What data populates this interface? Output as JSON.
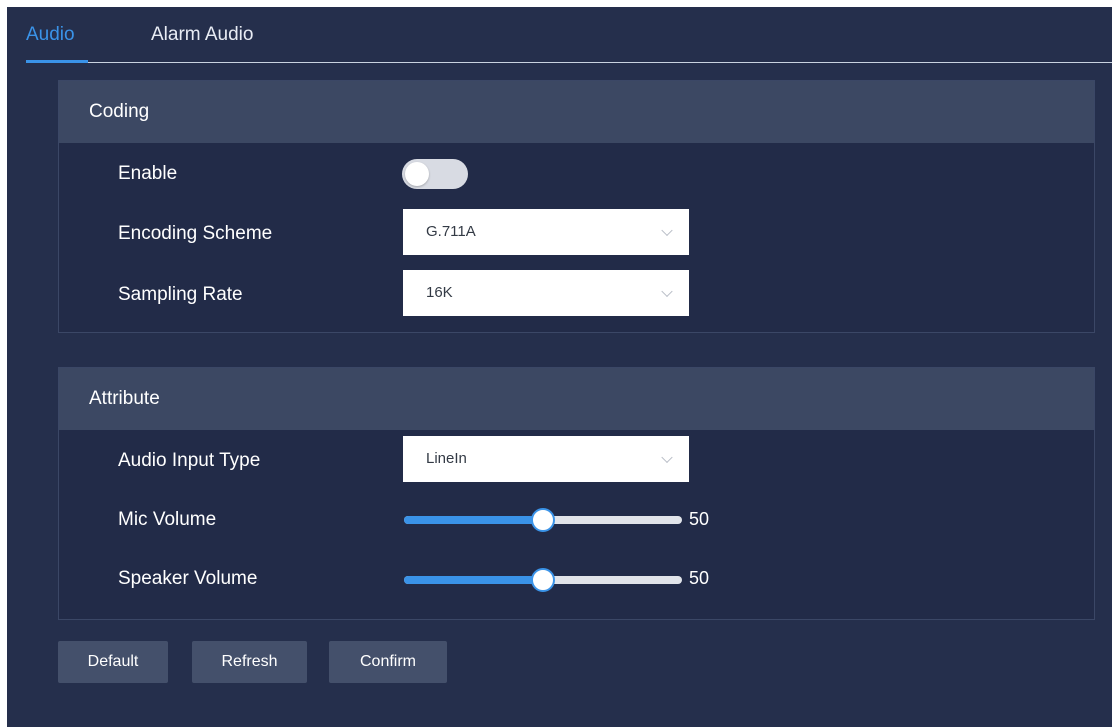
{
  "tabs": [
    {
      "label": "Audio",
      "active": true
    },
    {
      "label": "Alarm Audio",
      "active": false
    }
  ],
  "coding": {
    "title": "Coding",
    "enable": {
      "label": "Enable",
      "on": false
    },
    "encoding_scheme": {
      "label": "Encoding Scheme",
      "value": "G.711A"
    },
    "sampling_rate": {
      "label": "Sampling Rate",
      "value": "16K"
    }
  },
  "attribute": {
    "title": "Attribute",
    "audio_input_type": {
      "label": "Audio Input Type",
      "value": "LineIn"
    },
    "mic_volume": {
      "label": "Mic Volume",
      "value": 50,
      "display": "50"
    },
    "speaker_volume": {
      "label": "Speaker Volume",
      "value": 50,
      "display": "50"
    }
  },
  "buttons": {
    "default": "Default",
    "refresh": "Refresh",
    "confirm": "Confirm"
  },
  "colors": {
    "accent": "#3a93e8",
    "background": "#252f4c",
    "panel_header": "#3c4863",
    "button": "#44506b"
  },
  "icons": {
    "select_arrow": "chevron-down-icon"
  }
}
